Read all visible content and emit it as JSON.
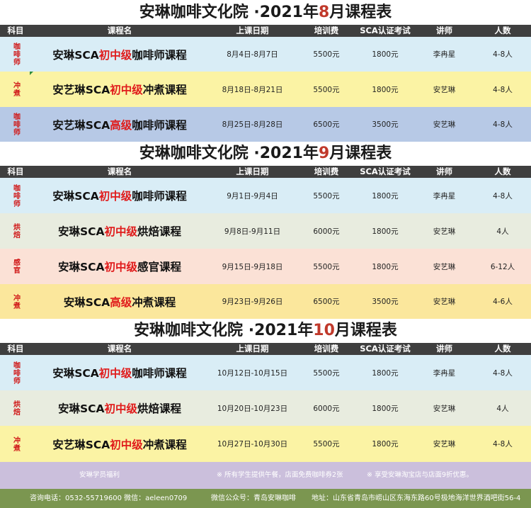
{
  "colors": {
    "header_bg": "#3f3f3f",
    "accent_red": "#e01b1b",
    "footer_purple": "#cbbfdc",
    "footer_green": "#7b9650"
  },
  "columns": [
    "科目",
    "课程名",
    "上课日期",
    "培训费",
    "SCA认证考试",
    "讲师",
    "人数"
  ],
  "tables": [
    {
      "title_prefix": "安琳咖啡文化院 ·2021年",
      "month": "8",
      "title_suffix": "月课程表",
      "rows": [
        {
          "subject": "咖啡师",
          "name_pre": "安琳SCA",
          "level": "初中级",
          "name_post": "咖啡师课程",
          "date": "8月4日-8月7日",
          "fee": "5500元",
          "exam": "1800元",
          "teacher": "李冉星",
          "people": "4-8人"
        },
        {
          "subject": "冲煮",
          "name_pre": "安艺琳SCA",
          "level": "初中级",
          "name_post": "冲煮课程",
          "date": "8月18日-8月21日",
          "fee": "5500元",
          "exam": "1800元",
          "teacher": "安艺琳",
          "people": "4-8人"
        },
        {
          "subject": "咖啡师",
          "name_pre": "安艺琳SCA",
          "level": "高级",
          "name_post": "咖啡师课程",
          "date": "8月25日-8月28日",
          "fee": "6500元",
          "exam": "3500元",
          "teacher": "安艺琳",
          "people": "4-8人"
        }
      ]
    },
    {
      "title_prefix": "安琳咖啡文化院 ·2021年",
      "month": "9",
      "title_suffix": "月课程表",
      "rows": [
        {
          "subject": "咖啡师",
          "name_pre": "安琳SCA",
          "level": "初中级",
          "name_post": "咖啡师课程",
          "date": "9月1日-9月4日",
          "fee": "5500元",
          "exam": "1800元",
          "teacher": "李冉星",
          "people": "4-8人"
        },
        {
          "subject": "烘焙",
          "name_pre": "安琳SCA",
          "level": "初中级",
          "name_post": "烘焙课程",
          "date": "9月8日-9月11日",
          "fee": "6000元",
          "exam": "1800元",
          "teacher": "安艺琳",
          "people": "4人"
        },
        {
          "subject": "感官",
          "name_pre": "安琳SCA",
          "level": "初中级",
          "name_post": "感官课程",
          "date": "9月15日-9月18日",
          "fee": "5500元",
          "exam": "1800元",
          "teacher": "安艺琳",
          "people": "6-12人"
        },
        {
          "subject": "冲煮",
          "name_pre": "安琳SCA",
          "level": "高级",
          "name_post": "冲煮课程",
          "date": "9月23日-9月26日",
          "fee": "6500元",
          "exam": "3500元",
          "teacher": "安艺琳",
          "people": "4-6人"
        }
      ]
    },
    {
      "title_prefix": "安琳咖啡文化院 ·2021年",
      "month": "10",
      "title_suffix": "月课程表",
      "rows": [
        {
          "subject": "咖啡师",
          "name_pre": "安琳SCA",
          "level": "初中级",
          "name_post": "咖啡师课程",
          "date": "10月12日-10月15日",
          "fee": "5500元",
          "exam": "1800元",
          "teacher": "李冉星",
          "people": "4-8人"
        },
        {
          "subject": "烘焙",
          "name_pre": "安琳SCA",
          "level": "初中级",
          "name_post": "烘焙课程",
          "date": "10月20日-10月23日",
          "fee": "6000元",
          "exam": "1800元",
          "teacher": "安艺琳",
          "people": "4人"
        },
        {
          "subject": "冲煮",
          "name_pre": "安艺琳SCA",
          "level": "初中级",
          "name_post": "冲煮课程",
          "date": "10月27日-10月30日",
          "fee": "5500元",
          "exam": "1800元",
          "teacher": "安艺琳",
          "people": "4-8人"
        }
      ]
    }
  ],
  "benefits": {
    "label": "安琳学员福利",
    "item1": "※ 所有学生提供午餐，店面免费咖啡券2张",
    "item2": "※ 享受安琳淘宝店与店面9折优惠。"
  },
  "contact": {
    "phone": "咨询电话：0532-55719600  微信：aeleen0709",
    "wechat": "微信公众号：青岛安琳咖啡",
    "address": "地址：山东省青岛市崂山区东海东路60号极地海洋世界酒吧街56-4"
  }
}
